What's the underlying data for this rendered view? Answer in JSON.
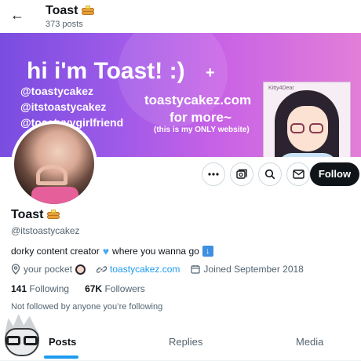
{
  "header": {
    "title": "Toast",
    "posts_count": "373 posts",
    "back_icon": "arrow-left-icon"
  },
  "banner": {
    "headline": "hi i'm Toast! :)",
    "plus": "+",
    "handles": [
      "@toastycakez",
      "@itstoastycakez",
      "@toastyyygirlfriend"
    ],
    "website_line1": "toastycakez.com",
    "website_line2": "for more~",
    "website_note": "(this is my ONLY website)",
    "artist_signature": "Kitty4Dear"
  },
  "actions": {
    "more_icon": "more-horizontal-icon",
    "subscribe_icon": "subscriptions-icon",
    "search_icon": "search-icon",
    "message_icon": "envelope-icon",
    "follow_label": "Follow"
  },
  "profile": {
    "display_name": "Toast",
    "handle": "@itstoastycakez",
    "bio_text": "dorky content creator",
    "bio_text2": "where you wanna go",
    "location": "your pocket",
    "website": "toastycakez.com",
    "joined": "Joined September 2018",
    "following_count": "141",
    "following_label": "Following",
    "followers_count": "67K",
    "followers_label": "Followers",
    "not_followed": "Not followed by anyone you’re following"
  },
  "tabs": [
    {
      "label": "Posts",
      "active": true
    },
    {
      "label": "Replies",
      "active": false
    },
    {
      "label": "Media",
      "active": false
    }
  ],
  "colors": {
    "accent": "#1d9bf0",
    "follow_bg": "#0f1419",
    "banner_start": "#7a4de0",
    "banner_end": "#e27ed8"
  }
}
